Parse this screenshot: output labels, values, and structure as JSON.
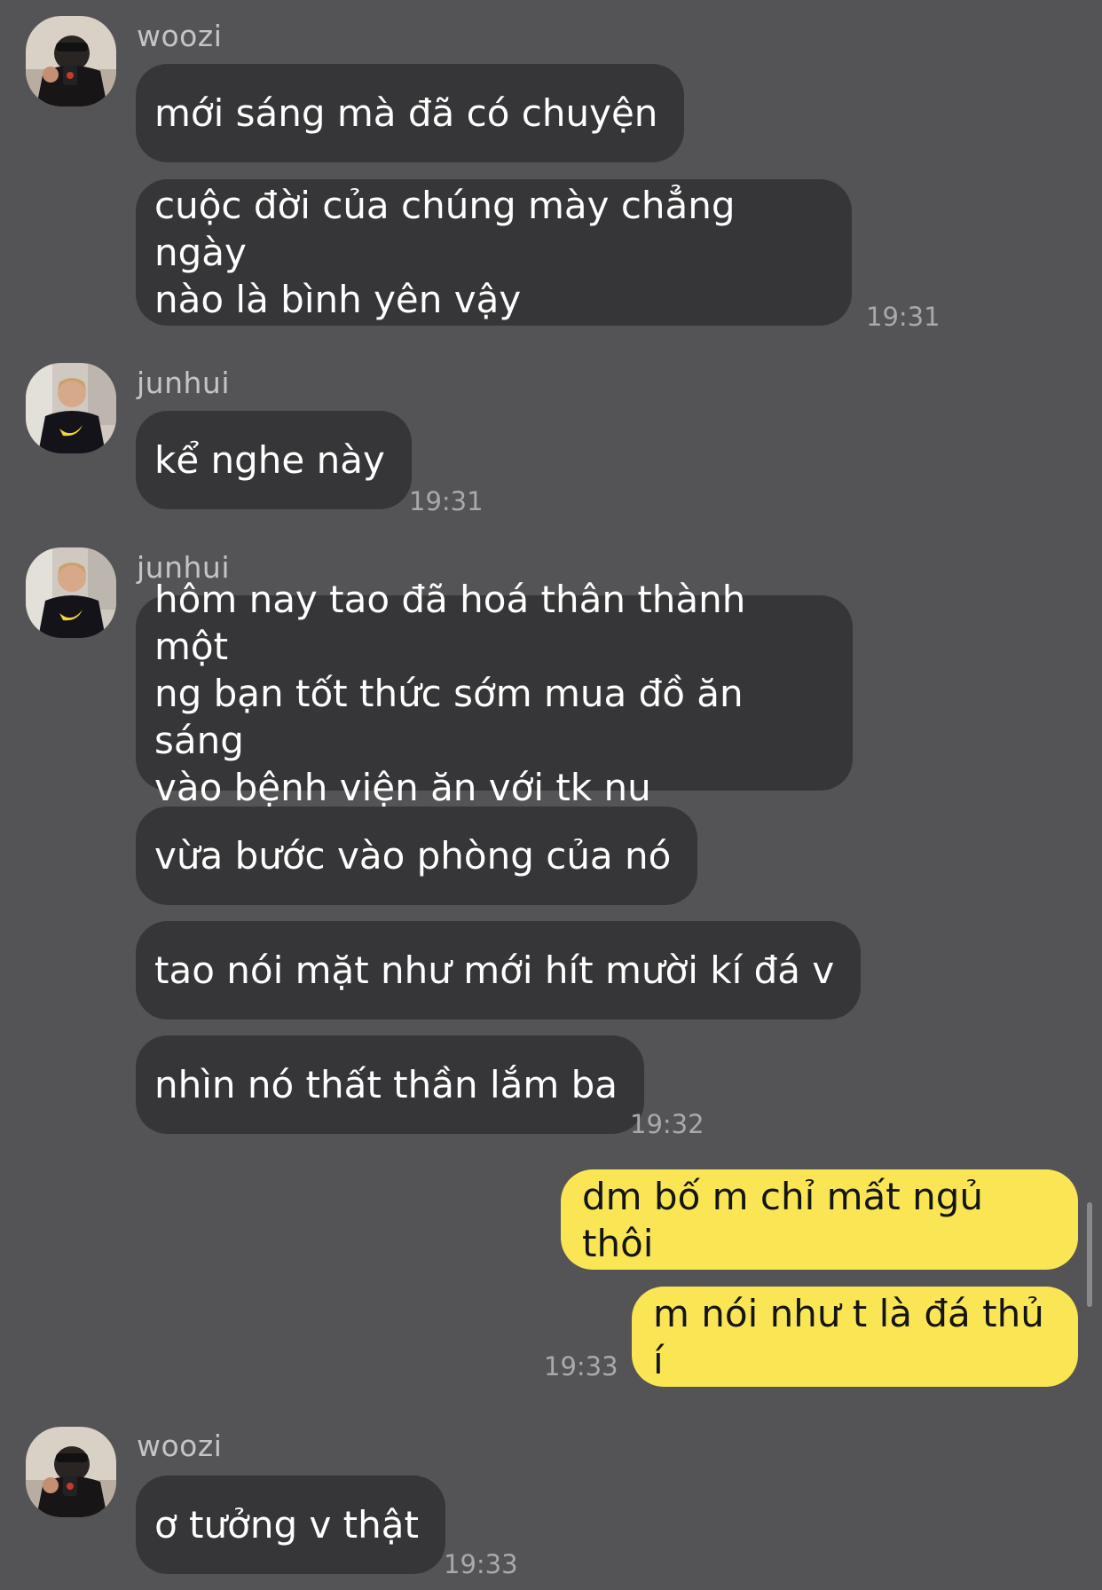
{
  "messages": [
    {
      "sender": "woozi",
      "texts": [
        "mới sáng mà đã có chuyện",
        "cuộc đời của chúng mày chẳng ngày\nnào là bình yên vậy"
      ],
      "time": "19:31"
    },
    {
      "sender": "junhui",
      "texts": [
        "kể nghe này"
      ],
      "time": "19:31"
    },
    {
      "sender": "junhui",
      "texts": [
        "hôm nay tao đã hoá thân thành một\nng bạn tốt thức sớm mua đồ ăn sáng\nvào bệnh viện ăn với tk nu",
        "vừa bước vào phòng của nó",
        "tao nói mặt như mới hít mười kí đá v",
        "nhìn nó thất thần lắm ba"
      ],
      "time": "19:32"
    },
    {
      "sender": "me",
      "texts": [
        "dm bố m chỉ mất ngủ thôi",
        "m nói như t là đá thủ í"
      ],
      "time": "19:33"
    },
    {
      "sender": "woozi",
      "texts": [
        "ơ tưởng v thật"
      ],
      "time": "19:33"
    }
  ],
  "colors": {
    "background": "#545355",
    "incoming_bubble": "#363537",
    "outgoing_bubble": "#fae654",
    "sender_name": "#c4c3c5",
    "timestamp": "#a9a8aa"
  },
  "icons": {
    "avatar_woozi": "avatar-woozi-photo",
    "avatar_junhui": "avatar-junhui-photo"
  }
}
